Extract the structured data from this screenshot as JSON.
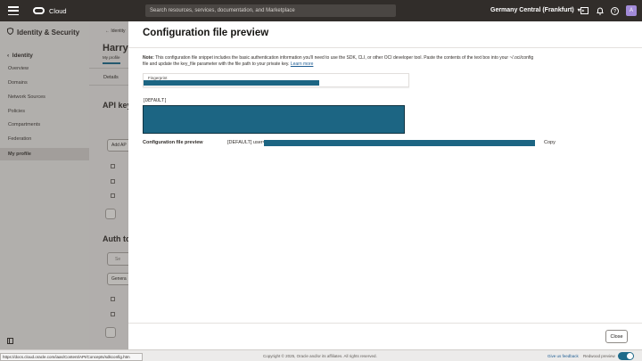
{
  "topbar": {
    "brand": "Cloud",
    "search_placeholder": "Search resources, services, documentation, and Marketplace",
    "region": "Germany Central (Frankfurt)",
    "avatar_letter": "A",
    "icons": [
      "cloud-shell-icon",
      "bell-icon",
      "globe-icon",
      "help-icon"
    ]
  },
  "sidebar": {
    "title": "Identity & Security",
    "back_label": "Identity",
    "items": [
      "Overview",
      "Domains",
      "Network Sources",
      "Policies",
      "Compartments",
      "Federation",
      "My profile"
    ],
    "active": "My profile"
  },
  "background": {
    "breadcrumb": "Identity",
    "name": "Harry",
    "subtitle": "My profile",
    "tab": "Details",
    "section1": "API key",
    "add_button": "Add AP",
    "section2": "Auth to",
    "search_snip": "Se",
    "generate_button": "Genera"
  },
  "dialog": {
    "title": "Configuration file preview",
    "note_label": "Note:",
    "note_text": "This configuration file snippet includes the basic authentication information you'll need to use the SDK, CLI, or other OCI developer tool. Paste the contents of the text box into your ~/.oci/config file and update the key_file parameter with the file path to your private key.",
    "learn_more": "Learn more",
    "fingerprint_label": "Fingerprint",
    "default_header": "[DEFAULT]",
    "preview_label": "Configuration file preview",
    "preview_text": "[DEFAULT] user=",
    "copy": "Copy",
    "close": "Close"
  },
  "footer": {
    "copyright": "Copyright © 2025, Oracle and/or its affiliates. All rights reserved.",
    "feedback": "Give us feedback",
    "redwood": "Redwood preview"
  },
  "status_url": "https://docs.cloud.oracle.com/iaas/Content/API/Concepts/sdkconfig.htm",
  "colors": {
    "redaction": "#1c6583",
    "topbar": "#312d2a",
    "accent_link": "#1f5d93"
  }
}
